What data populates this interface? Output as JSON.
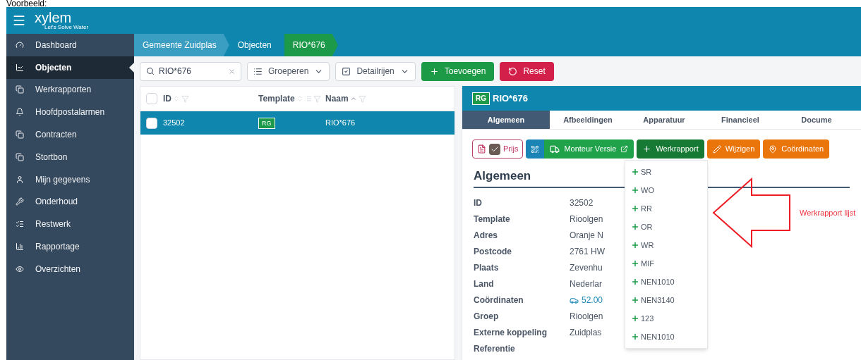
{
  "caption": "Voorbeeld:",
  "app": {
    "logo": "xylem",
    "tagline": "Let's Solve Water"
  },
  "sidebar": {
    "items": [
      {
        "label": "Dashboard",
        "selected": false
      },
      {
        "label": "Objecten",
        "selected": true
      },
      {
        "label": "Werkrapporten",
        "selected": false
      },
      {
        "label": "Hoofdpostalarmen",
        "selected": false
      },
      {
        "label": "Contracten",
        "selected": false
      },
      {
        "label": "Stortbon",
        "selected": false
      },
      {
        "label": "Mijn gegevens",
        "selected": false
      },
      {
        "label": "Onderhoud",
        "selected": false
      },
      {
        "label": "Restwerk",
        "selected": false
      },
      {
        "label": "Rapportage",
        "selected": false
      },
      {
        "label": "Overzichten",
        "selected": false
      }
    ]
  },
  "breadcrumb": [
    {
      "label": "Gemeente Zuidplas",
      "selected": false
    },
    {
      "label": "Objecten",
      "selected": false
    },
    {
      "label": "RIO*676",
      "selected": true
    }
  ],
  "toolbar": {
    "search": {
      "value": "RIO*676"
    },
    "buttons": [
      {
        "label": "Groeperen",
        "kind": "group"
      },
      {
        "label": "Detailrijen",
        "kind": "rows"
      },
      {
        "label": "Toevoegen",
        "kind": "add"
      },
      {
        "label": "Reset",
        "kind": "reset"
      }
    ]
  },
  "table": {
    "all_checked": false,
    "columns": [
      "ID",
      "Template",
      "Naam"
    ],
    "rows": [
      {
        "id": "32502",
        "template": "RG",
        "naam": "RIO*676",
        "selected": true,
        "checked": false
      }
    ]
  },
  "detail": {
    "badge": "RG",
    "title": "RIO*676",
    "tabs": [
      {
        "label": "Algemeen",
        "selected": true
      },
      {
        "label": "Afbeeldingen",
        "selected": false
      },
      {
        "label": "Apparatuur",
        "selected": false
      },
      {
        "label": "Financieel",
        "selected": false
      },
      {
        "label": "Docume",
        "selected": false
      }
    ],
    "actions": [
      {
        "label": "Prijs",
        "kind": "price",
        "checked": true
      },
      {
        "label": "Monteur Versie",
        "kind": "monteur"
      },
      {
        "label": "Werkrapport",
        "kind": "werkrapport"
      },
      {
        "label": "Wijzigen",
        "kind": "edit"
      },
      {
        "label": "Coördinaten",
        "kind": "coords"
      }
    ],
    "section": "Algemeen",
    "fields": [
      {
        "label": "ID",
        "value": "32502",
        "kind": "text"
      },
      {
        "label": "Template",
        "value": "Rioolgen",
        "kind": "text"
      },
      {
        "label": "Adres",
        "value": "Oranje N",
        "kind": "text"
      },
      {
        "label": "Postcode",
        "value": "2761 HW",
        "kind": "text"
      },
      {
        "label": "Plaats",
        "value": "Zevenhu",
        "kind": "text"
      },
      {
        "label": "Land",
        "value": "Nederlar",
        "kind": "text"
      },
      {
        "label": "Coördinaten",
        "value": "52.00",
        "kind": "location"
      },
      {
        "label": "Groep",
        "value": "Rioolgen",
        "kind": "text"
      },
      {
        "label": "Externe koppeling",
        "value": "Zuidplas",
        "kind": "text"
      },
      {
        "label": "Referentie",
        "kind": "text"
      }
    ],
    "menu": {
      "items": [
        "SR",
        "WO",
        "RR",
        "OR",
        "WR",
        "MIF",
        "NEN1010",
        "NEN3140",
        "123",
        "NEN1010"
      ]
    }
  },
  "annotation": {
    "text": "Werkrapport lijst"
  }
}
